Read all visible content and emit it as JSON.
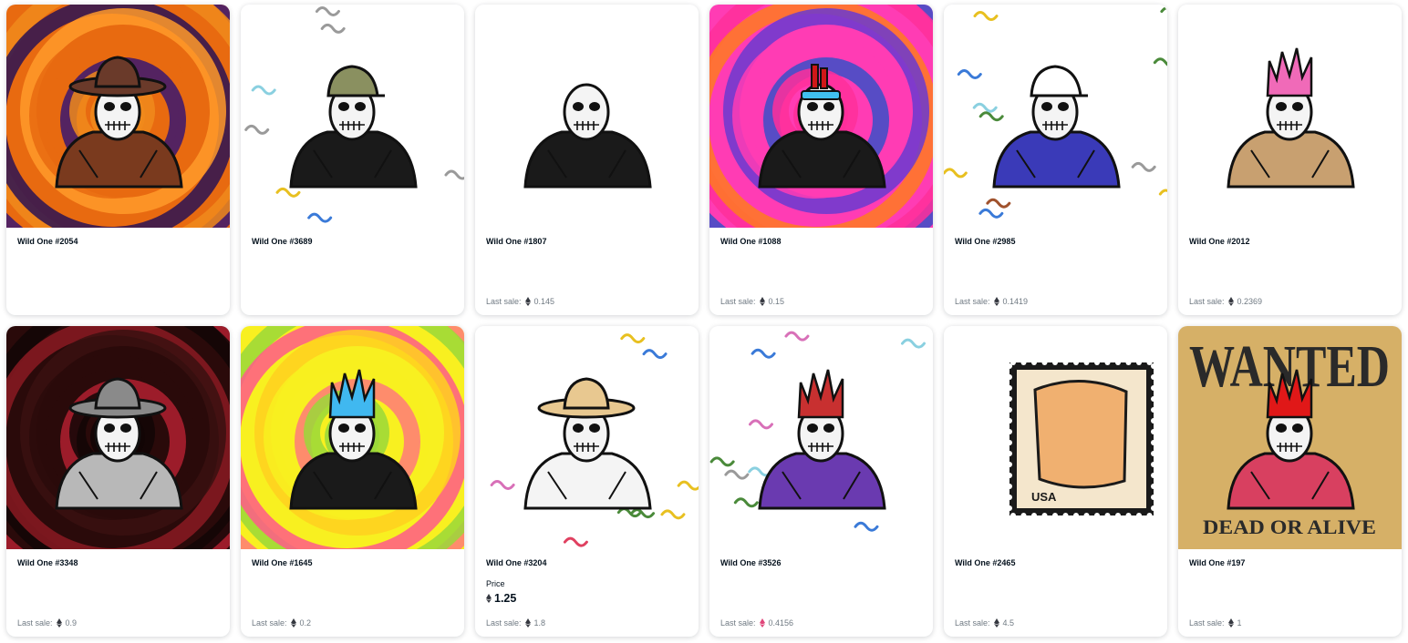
{
  "last_sale_label": "Last sale:",
  "price_label": "Price",
  "colors": {
    "eth": "#353840",
    "eth_pink": "#e0467a",
    "text": "#04111d",
    "muted": "#707a83"
  },
  "items": [
    {
      "name": "Wild One #2054",
      "last_sale": "",
      "price": "",
      "art": "swirl-orange-purple",
      "hat": "cowboy-hat-brown",
      "outfit": "brown-coat"
    },
    {
      "name": "Wild One #3689",
      "last_sale": "",
      "price": "",
      "art": "white-confetti",
      "hat": "army-cap",
      "outfit": "black-leather-jacket"
    },
    {
      "name": "Wild One #1807",
      "last_sale": "0.145",
      "price": "",
      "art": "white-plain",
      "hat": "none",
      "outfit": "black-leather-jacket"
    },
    {
      "name": "Wild One #1088",
      "last_sale": "0.15",
      "price": "",
      "art": "swirl-pink-blue",
      "hat": "dynamite",
      "outfit": "black-leather-jacket"
    },
    {
      "name": "Wild One #2985",
      "last_sale": "0.1419",
      "price": "",
      "art": "white-confetti",
      "hat": "malibu-high-cap",
      "outfit": "blue-jacket"
    },
    {
      "name": "Wild One #2012",
      "last_sale": "0.2369",
      "price": "",
      "art": "white-plain",
      "hat": "pink-hair",
      "outfit": "camo-jacket"
    },
    {
      "name": "Wild One #3348",
      "last_sale": "0.9",
      "price": "",
      "art": "swirl-red-black",
      "hat": "grey-hat",
      "outfit": "grey-suit"
    },
    {
      "name": "Wild One #1645",
      "last_sale": "0.2",
      "price": "",
      "art": "swirl-yellow-pink",
      "hat": "blue-flame-hair",
      "outfit": "black-leather-jacket"
    },
    {
      "name": "Wild One #3204",
      "last_sale": "1.8",
      "price": "1.25",
      "art": "white-confetti",
      "hat": "cowboy-hat-tan",
      "outfit": "striped-shirt"
    },
    {
      "name": "Wild One #3526",
      "last_sale": "0.4156",
      "price": "",
      "art": "white-confetti",
      "hat": "red-hair",
      "outfit": "purple-jacket",
      "eth_color": "pink"
    },
    {
      "name": "Wild One #2465",
      "last_sale": "4.5",
      "price": "",
      "art": "usa-stamp",
      "stamp_text": "USA",
      "hat": "bag-head",
      "outfit": "none"
    },
    {
      "name": "Wild One #197",
      "last_sale": "1",
      "price": "",
      "art": "wanted-poster",
      "poster_top": "WANTED",
      "poster_bottom": "DEAD OR ALIVE",
      "hat": "red-flame-hair",
      "outfit": "red-shirt"
    }
  ]
}
